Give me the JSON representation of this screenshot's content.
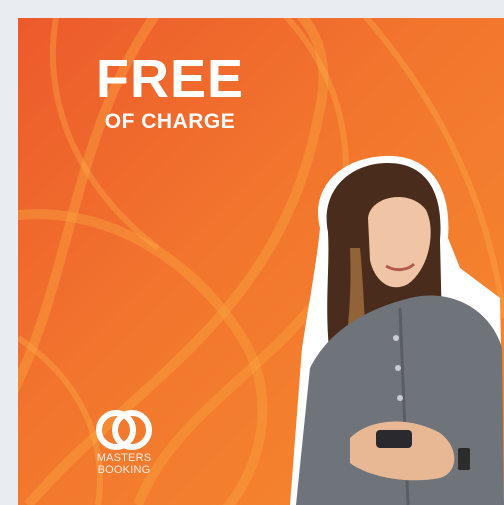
{
  "promo": {
    "headline_big": "FREE",
    "headline_small": "OF CHARGE"
  },
  "brand": {
    "line1": "MASTERS",
    "line2": "BOOKING"
  },
  "colors": {
    "background": "#f2762d",
    "page": "#e9edf2",
    "text": "#ffffff"
  },
  "icons": {
    "logo": "interlocking-rings-icon"
  }
}
